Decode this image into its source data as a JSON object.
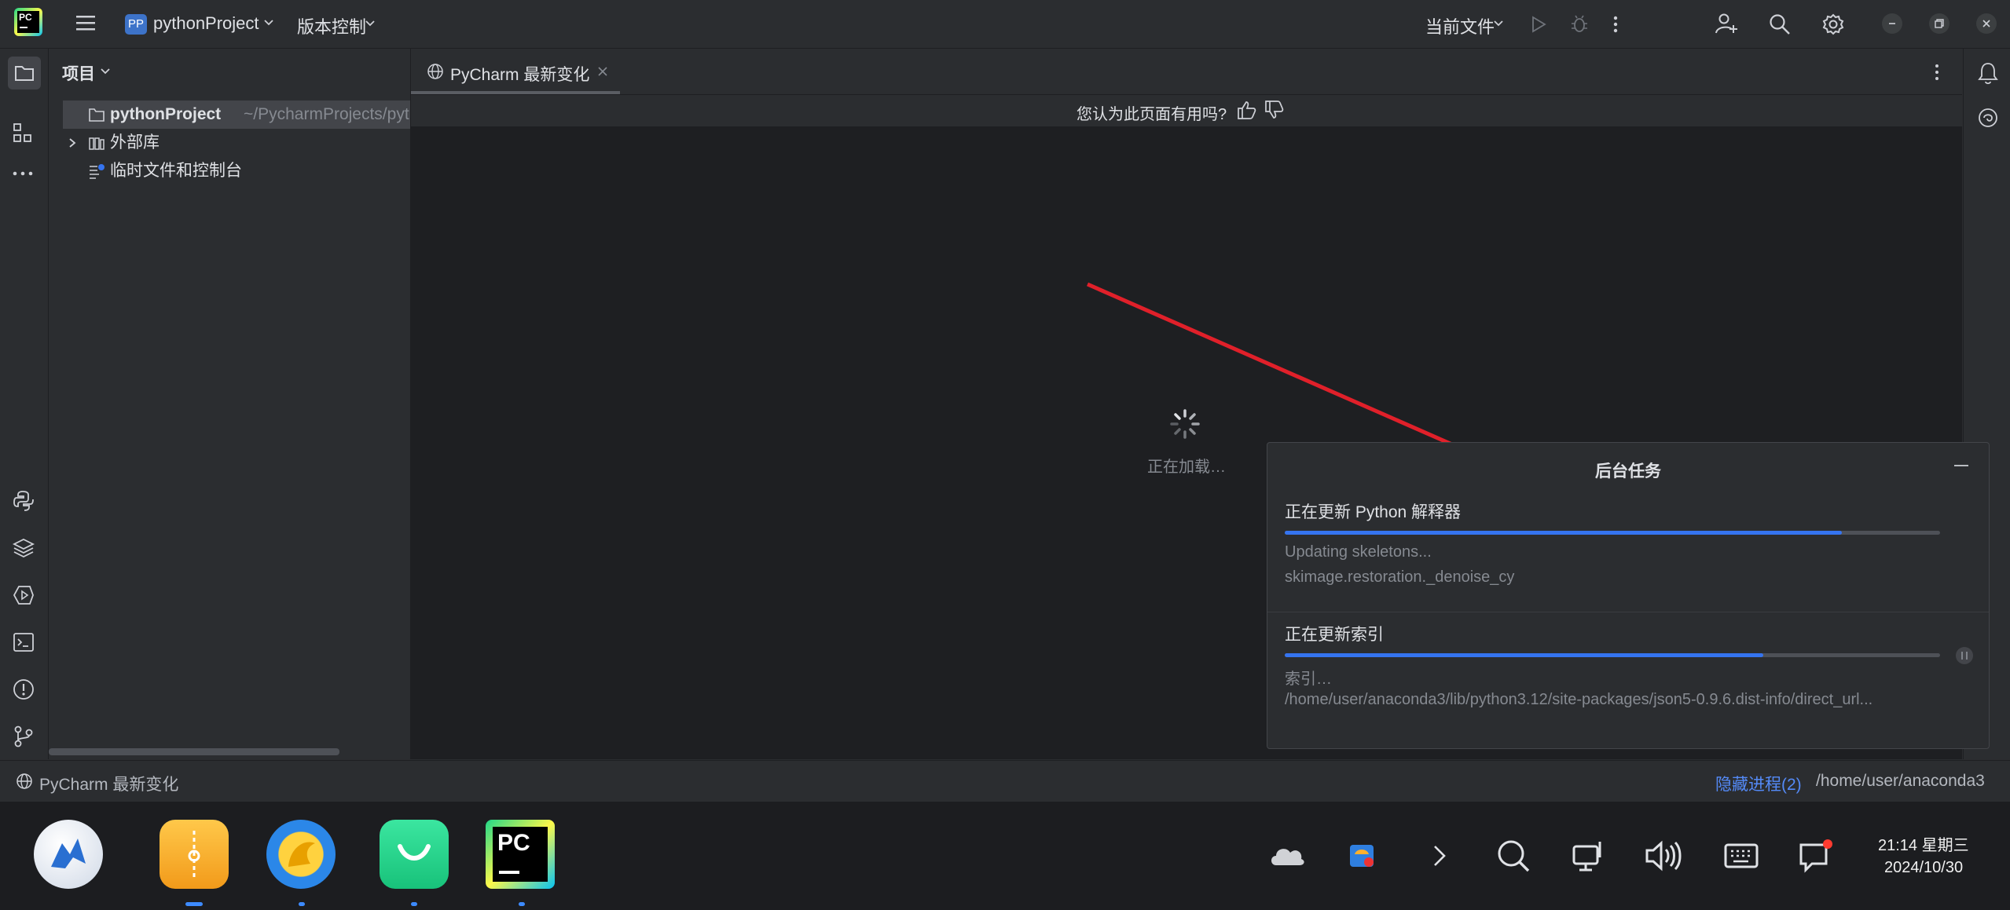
{
  "titlebar": {
    "app_badge": "PC",
    "project_badge": "PP",
    "project_name": "pythonProject",
    "vcs_label": "版本控制",
    "run_config": "当前文件"
  },
  "project_panel": {
    "title": "项目",
    "tree": [
      {
        "label": "pythonProject",
        "path": "~/PycharmProjects/pyth"
      },
      {
        "label": "外部库"
      },
      {
        "label": "临时文件和控制台"
      }
    ]
  },
  "editor": {
    "tab_label": "PyCharm 最新变化",
    "feedback_question": "您认为此页面有用吗?",
    "loading_text": "正在加载…"
  },
  "bg_tasks": {
    "title": "后台任务",
    "tasks": [
      {
        "title": "正在更新 Python 解释器",
        "progress": 0.85,
        "line1": "Updating skeletons...",
        "line2": "skimage.restoration._denoise_cy"
      },
      {
        "title": "正在更新索引",
        "progress": 0.73,
        "line1": "索引…",
        "line2": "/home/user/anaconda3/lib/python3.12/site-packages/json5-0.9.6.dist-info/direct_url..."
      }
    ]
  },
  "statusbar": {
    "left_label": "PyCharm 最新变化",
    "hidden_processes": "隐藏进程(2)",
    "interpreter_path": "/home/user/anaconda3"
  },
  "taskbar": {
    "time": "21:14 星期三",
    "date": "2024/10/30",
    "pycharm_badge": "PC"
  },
  "colors": {
    "accent": "#3574f0",
    "annotation_arrow": "#e0202a",
    "background": "#2b2d30",
    "editor_bg": "#1e1f22"
  }
}
